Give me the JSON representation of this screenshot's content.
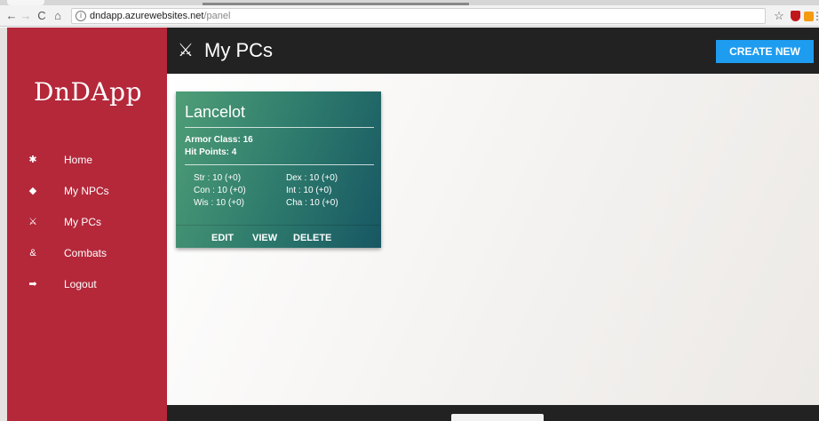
{
  "browser": {
    "back": "←",
    "forward": "→",
    "reload": "C",
    "home": "⌂",
    "info": "i",
    "url_host": "dndapp.azurewebsites.net",
    "url_path": "/panel",
    "star": "☆",
    "more": "⋮"
  },
  "app": {
    "brand": "DnDApp"
  },
  "sidebar": {
    "items": [
      {
        "label": "Home",
        "icon": "home-icon",
        "glyph": "✱"
      },
      {
        "label": "My NPCs",
        "icon": "shield-icon",
        "glyph": "◆"
      },
      {
        "label": "My PCs",
        "icon": "sword-icon",
        "glyph": "⚔"
      },
      {
        "label": "Combats",
        "icon": "combat-icon",
        "glyph": "&"
      },
      {
        "label": "Logout",
        "icon": "logout-icon",
        "glyph": "➡"
      }
    ]
  },
  "header": {
    "title_glyph": "⚔",
    "title": "My PCs",
    "create_label": "CREATE NEW"
  },
  "cards": [
    {
      "name": "Lancelot",
      "armor_class": "Armor Class: 16",
      "hit_points": "Hit Points: 4",
      "stats": {
        "str": "Str : 10 (+0)",
        "dex": "Dex : 10 (+0)",
        "con": "Con : 10 (+0)",
        "int": "Int : 10 (+0)",
        "wis": "Wis : 10 (+0)",
        "cha": "Cha : 10 (+0)"
      },
      "actions": {
        "edit": "EDIT",
        "view": "VIEW",
        "delete": "DELETE"
      }
    }
  ],
  "colors": {
    "sidebar": "#b4283a",
    "header": "#222222",
    "accent": "#1e9cf0",
    "card_start": "#4f9e77",
    "card_end": "#175763"
  }
}
